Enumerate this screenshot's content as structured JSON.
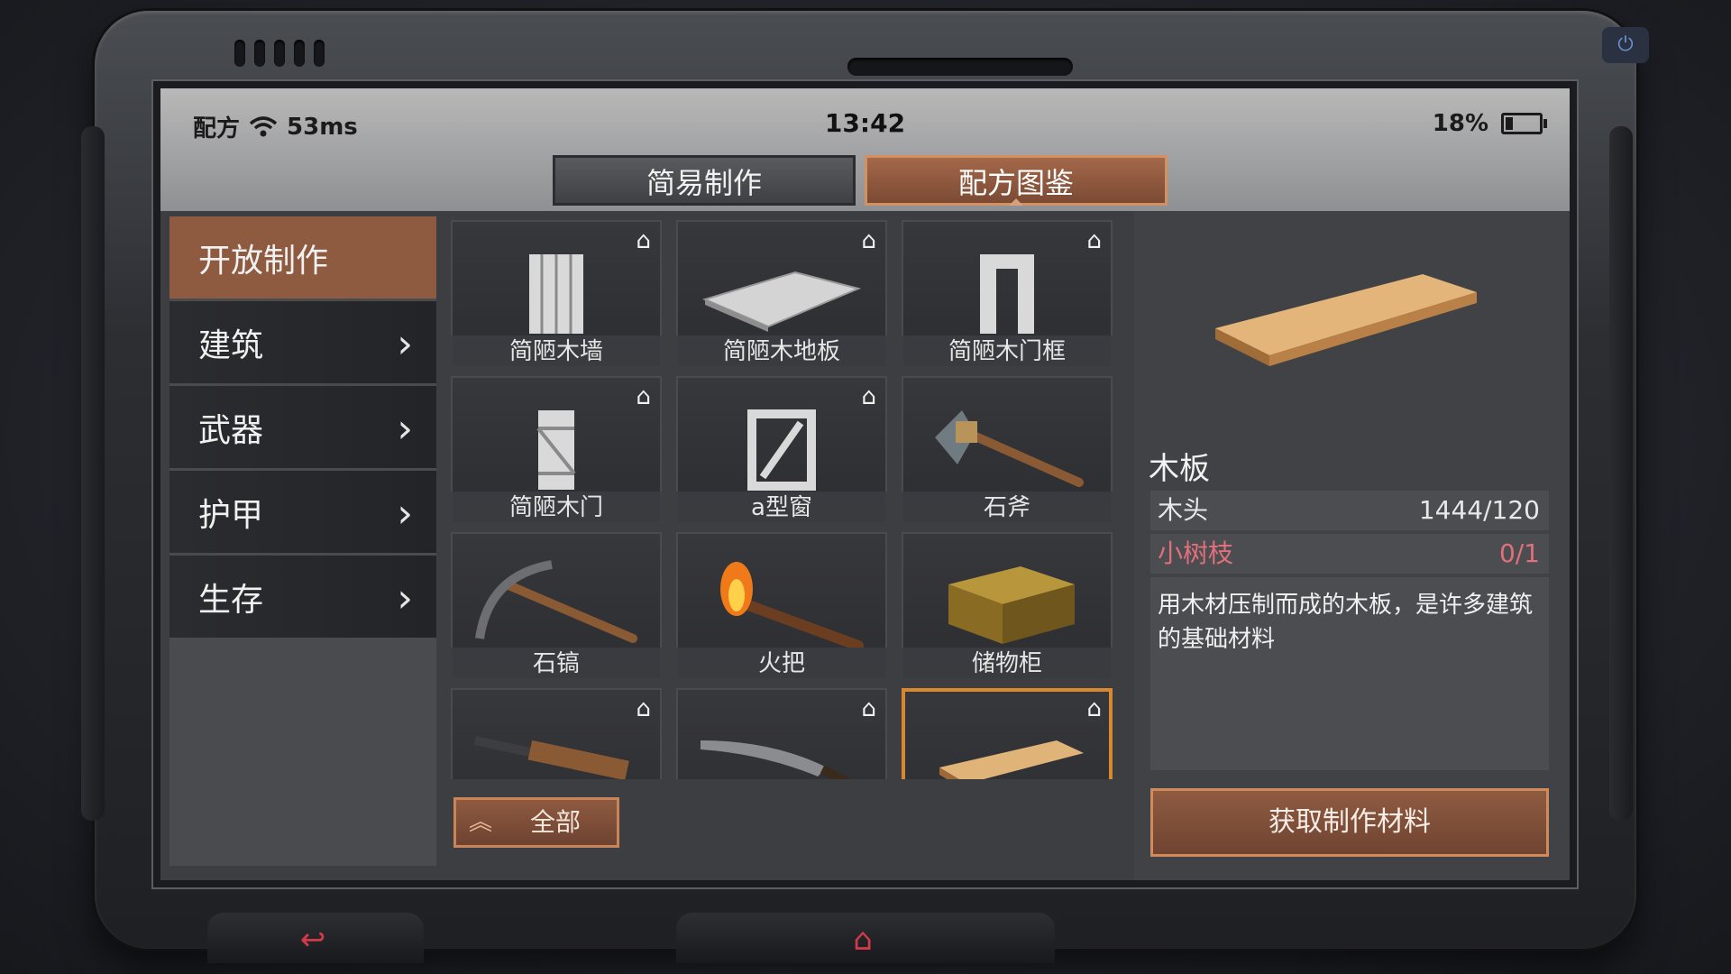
{
  "statusbar": {
    "app_label": "配方",
    "ping": "53ms",
    "time": "13:42",
    "battery": "18%"
  },
  "tabs": [
    {
      "label": "简易制作",
      "active": false
    },
    {
      "label": "配方图鉴",
      "active": true
    }
  ],
  "sidebar": {
    "items": [
      {
        "label": "开放制作",
        "active": true
      },
      {
        "label": "建筑",
        "active": false
      },
      {
        "label": "武器",
        "active": false
      },
      {
        "label": "护甲",
        "active": false
      },
      {
        "label": "生存",
        "active": false
      }
    ]
  },
  "grid": {
    "items": [
      {
        "label": "简陋木墙",
        "home_icon": true
      },
      {
        "label": "简陋木地板",
        "home_icon": true
      },
      {
        "label": "简陋木门框",
        "home_icon": true
      },
      {
        "label": "简陋木门",
        "home_icon": true
      },
      {
        "label": "a型窗",
        "home_icon": true
      },
      {
        "label": "石斧",
        "home_icon": false
      },
      {
        "label": "石镐",
        "home_icon": false
      },
      {
        "label": "火把",
        "home_icon": false
      },
      {
        "label": "储物柜",
        "home_icon": false
      },
      {
        "label": "",
        "home_icon": true
      },
      {
        "label": "",
        "home_icon": true
      },
      {
        "label": "",
        "home_icon": true,
        "selected": true
      }
    ],
    "all_button": "全部"
  },
  "detail": {
    "title": "木板",
    "materials": [
      {
        "name": "木头",
        "value": "1444/120",
        "color": "#e8e8e8"
      },
      {
        "name": "小树枝",
        "value": "0/1",
        "color": "#e0707a"
      }
    ],
    "description": "用木材压制而成的木板，是许多建筑的基础材料",
    "get_button": "获取制作材料"
  },
  "colors": {
    "accent": "#8e5b41",
    "accent_border": "#d08a5b",
    "selected_border": "#d8892f",
    "nav_red": "#d23a4a"
  },
  "icons": {
    "home": "⌂",
    "chevron": "›",
    "back": "↩",
    "up": "︽"
  }
}
